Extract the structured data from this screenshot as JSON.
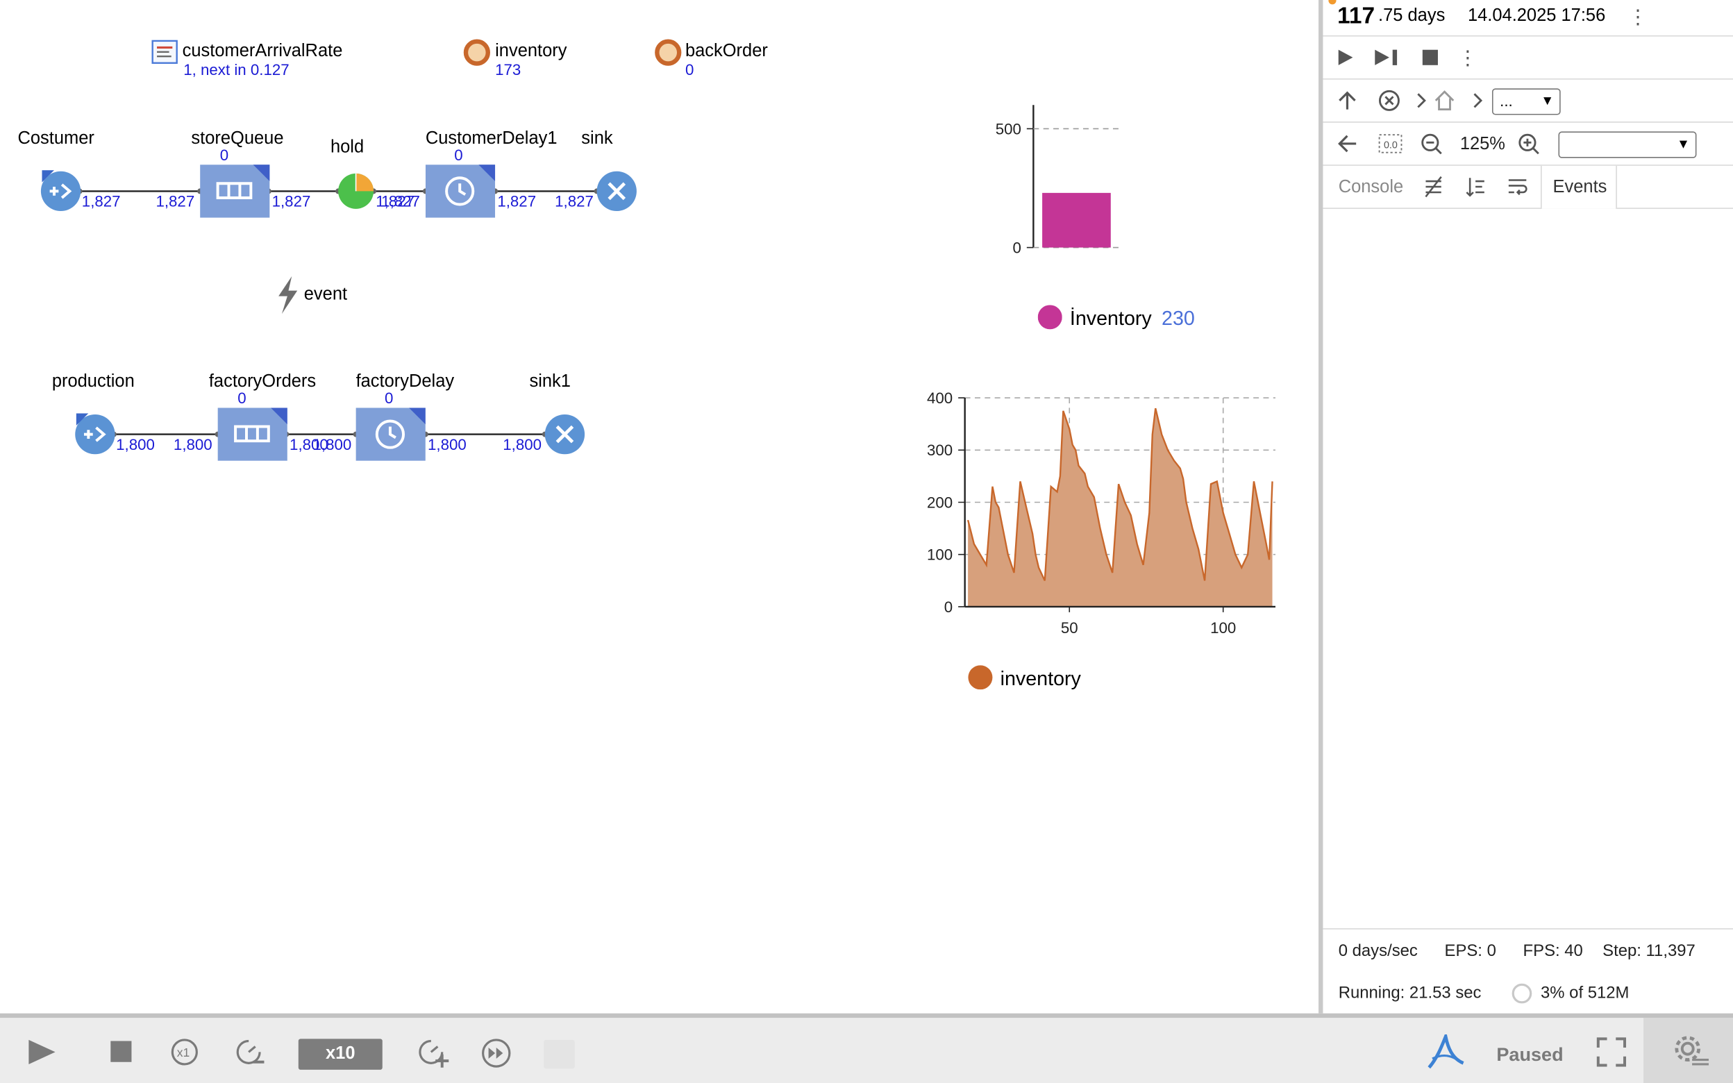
{
  "model": {
    "params": {
      "customerArrivalRate": {
        "label": "customerArrivalRate",
        "value": "1, next in 0.127"
      },
      "inventory": {
        "label": "inventory",
        "value": "173"
      },
      "backOrder": {
        "label": "backOrder",
        "value": "0"
      }
    },
    "flow1": {
      "source": {
        "label": "Costumer",
        "out": "1,827"
      },
      "queue": {
        "label": "storeQueue",
        "count": "0",
        "in": "1,827",
        "out": "1,827"
      },
      "hold": {
        "label": "hold",
        "in_out": "1,827"
      },
      "delay": {
        "label": "CustomerDelay1",
        "count": "0",
        "in": "1,827",
        "out": "1,827"
      },
      "sink": {
        "label": "sink",
        "in": "1,827"
      }
    },
    "event": {
      "label": "event"
    },
    "flow2": {
      "source": {
        "label": "production",
        "out": "1,800"
      },
      "queue": {
        "label": "factoryOrders",
        "count": "0",
        "in": "1,800",
        "out": "1,800"
      },
      "delay": {
        "label": "factoryDelay",
        "count": "0",
        "in": "1,800",
        "out": "1,800"
      },
      "sink": {
        "label": "sink1",
        "in": "1,800"
      }
    }
  },
  "chart_data": [
    {
      "type": "bar",
      "categories": [
        "İnventory"
      ],
      "values": [
        230
      ],
      "series": [
        {
          "name": "İnventory",
          "values": [
            230
          ],
          "color": "#c43596"
        }
      ],
      "ylim": [
        0,
        600
      ],
      "yticks": [
        "0",
        "500"
      ],
      "legend": {
        "label": "İnventory",
        "value": "230"
      },
      "grid": true,
      "legend_position": "bottom"
    },
    {
      "type": "area",
      "series": [
        {
          "name": "inventory",
          "color": "#c8672b"
        }
      ],
      "x": [
        17,
        19,
        21,
        23,
        25,
        26,
        27,
        28,
        30,
        32,
        34,
        36,
        38,
        39,
        40,
        42,
        44,
        46,
        47,
        48,
        50,
        51,
        52,
        53,
        55,
        56,
        58,
        60,
        62,
        64,
        66,
        68,
        70,
        72,
        74,
        76,
        77,
        78,
        80,
        82,
        84,
        86,
        87,
        88,
        90,
        92,
        93,
        94,
        96,
        98,
        100,
        102,
        104,
        106,
        108,
        110,
        112,
        114,
        115,
        116
      ],
      "y": [
        166,
        120,
        100,
        80,
        230,
        200,
        190,
        160,
        100,
        65,
        240,
        190,
        140,
        100,
        75,
        50,
        230,
        220,
        250,
        375,
        340,
        310,
        300,
        270,
        255,
        230,
        210,
        150,
        100,
        65,
        235,
        200,
        175,
        120,
        80,
        180,
        330,
        380,
        330,
        300,
        280,
        265,
        245,
        200,
        150,
        110,
        80,
        50,
        235,
        240,
        180,
        140,
        100,
        75,
        100,
        240,
        180,
        120,
        90,
        240
      ],
      "xticks": [
        50,
        100
      ],
      "yticks": [
        0,
        100,
        200,
        300,
        400
      ],
      "xlim": [
        16,
        117
      ],
      "ylim": [
        0,
        400
      ],
      "grid": true,
      "legend": {
        "label": "inventory"
      },
      "legend_position": "bottom"
    }
  ],
  "panel": {
    "time_int": "117",
    "time_frac": ".75 days",
    "date": "14.04.2025 17:56",
    "nav_select": "...",
    "zoom": "125%",
    "view_select": "",
    "tabs": {
      "console": "Console",
      "events": "Events"
    },
    "stats": {
      "speed": "0 days/sec",
      "eps": "EPS: 0",
      "fps": "FPS: 40",
      "step": "Step: 11,397",
      "running": "Running: 21.53 sec",
      "memory": "3% of 512M"
    }
  },
  "toolbar": {
    "speed": "x10",
    "status": "Paused"
  }
}
